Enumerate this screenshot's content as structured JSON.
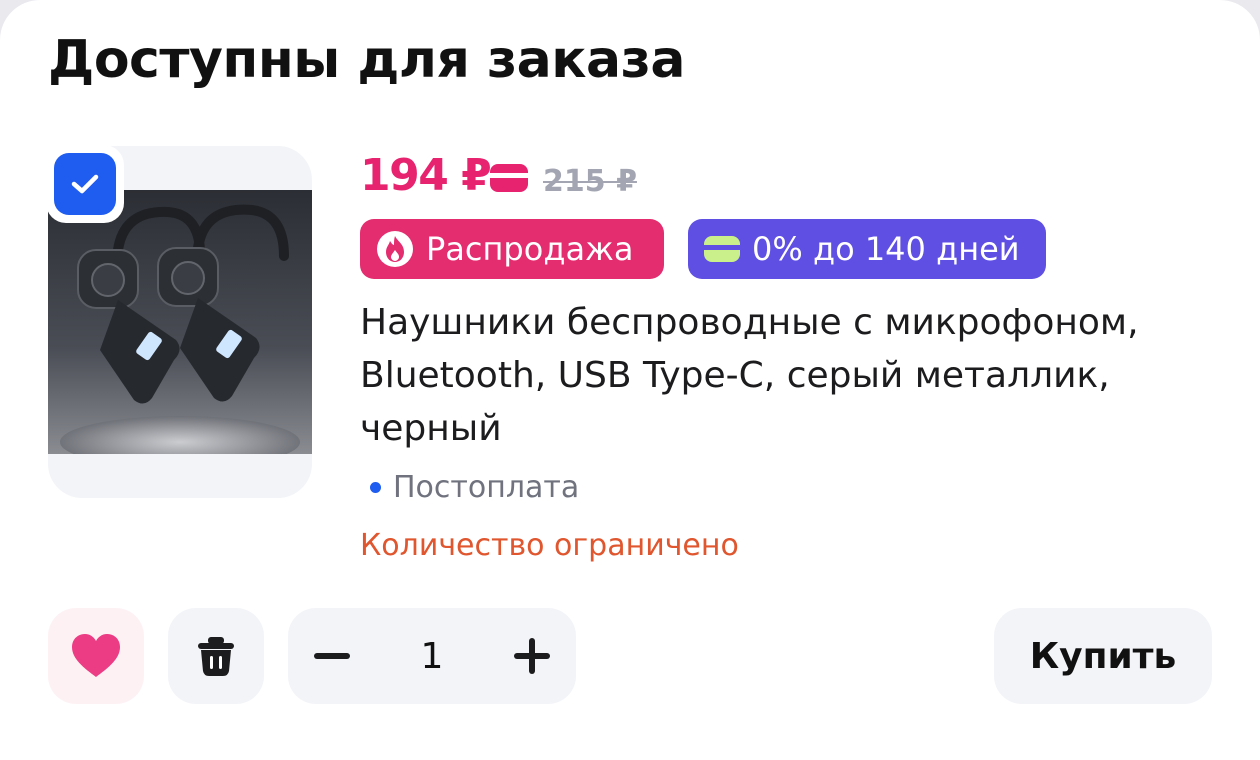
{
  "section": {
    "title": "Доступны для заказа"
  },
  "product": {
    "selected": true,
    "price": "194 ₽",
    "old_price": "215 ₽",
    "badges": {
      "sale": {
        "label": "Распродажа",
        "icon": "fire-icon",
        "color": "#e32d6f"
      },
      "installment": {
        "label": "0% до 140 дней",
        "icon": "card-icon",
        "color": "#5f4fe3"
      }
    },
    "name": "Наушники беспроводные с микрофоном, Bluetooth, USB Type-C, серый металлик, черный",
    "payment": "Постоплата",
    "stock_note": "Количество ограничено",
    "quantity": "1"
  },
  "actions": {
    "favorite_icon": "heart-icon",
    "delete_icon": "trash-icon",
    "decrement_icon": "minus-icon",
    "increment_icon": "plus-icon",
    "buy_label": "Купить"
  },
  "colors": {
    "accent_blue": "#1f5cf0",
    "price_pink": "#e7236f",
    "warning_orange": "#e0562e"
  }
}
